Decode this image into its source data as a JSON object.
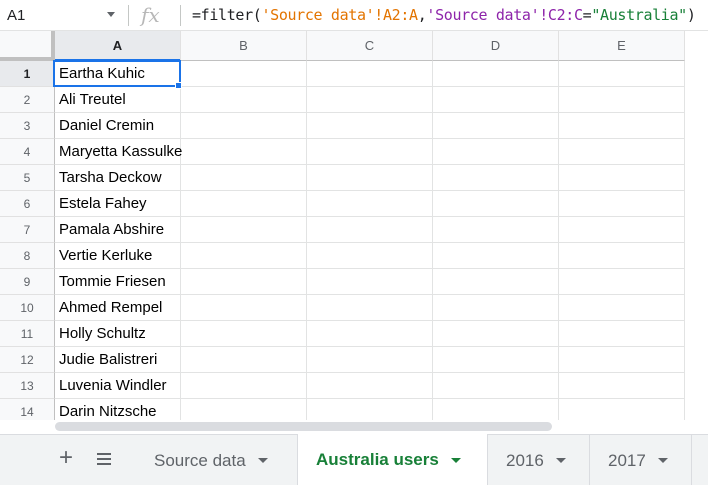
{
  "formula_bar": {
    "name_box": "A1",
    "fx_symbol": "fx",
    "formula": {
      "prefix": "=filter(",
      "range1": "'Source data'!A2:A",
      "comma": ",",
      "range2": "'Source data'!C2:C",
      "eq": "=",
      "criterion": "\"Australia\"",
      "suffix": ")"
    }
  },
  "grid": {
    "columns": [
      "A",
      "B",
      "C",
      "D",
      "E"
    ],
    "rows": [
      "1",
      "2",
      "3",
      "4",
      "5",
      "6",
      "7",
      "8",
      "9",
      "10",
      "11",
      "12",
      "13",
      "14"
    ],
    "column_a_values": [
      "Eartha Kuhic",
      "Ali Treutel",
      "Daniel Cremin",
      "Maryetta Kassulke",
      "Tarsha Deckow",
      "Estela Fahey",
      "Pamala Abshire",
      "Vertie Kerluke",
      "Tommie Friesen",
      "Ahmed Rempel",
      "Holly Schultz",
      "Judie Balistreri",
      "Luvenia Windler",
      "Darin Nitzsche"
    ],
    "selected_cell": "A1"
  },
  "tabs": {
    "add_label": "+",
    "sheets": [
      {
        "label": "Source data",
        "active": false
      },
      {
        "label": "Australia users",
        "active": true
      },
      {
        "label": "2016",
        "active": false
      },
      {
        "label": "2017",
        "active": false
      }
    ]
  },
  "colors": {
    "accent": "#1a73e8",
    "active_tab": "#188038",
    "formula_sheet_ref": "#e37400",
    "formula_range_ref": "#8e24aa",
    "formula_string": "#188038"
  }
}
